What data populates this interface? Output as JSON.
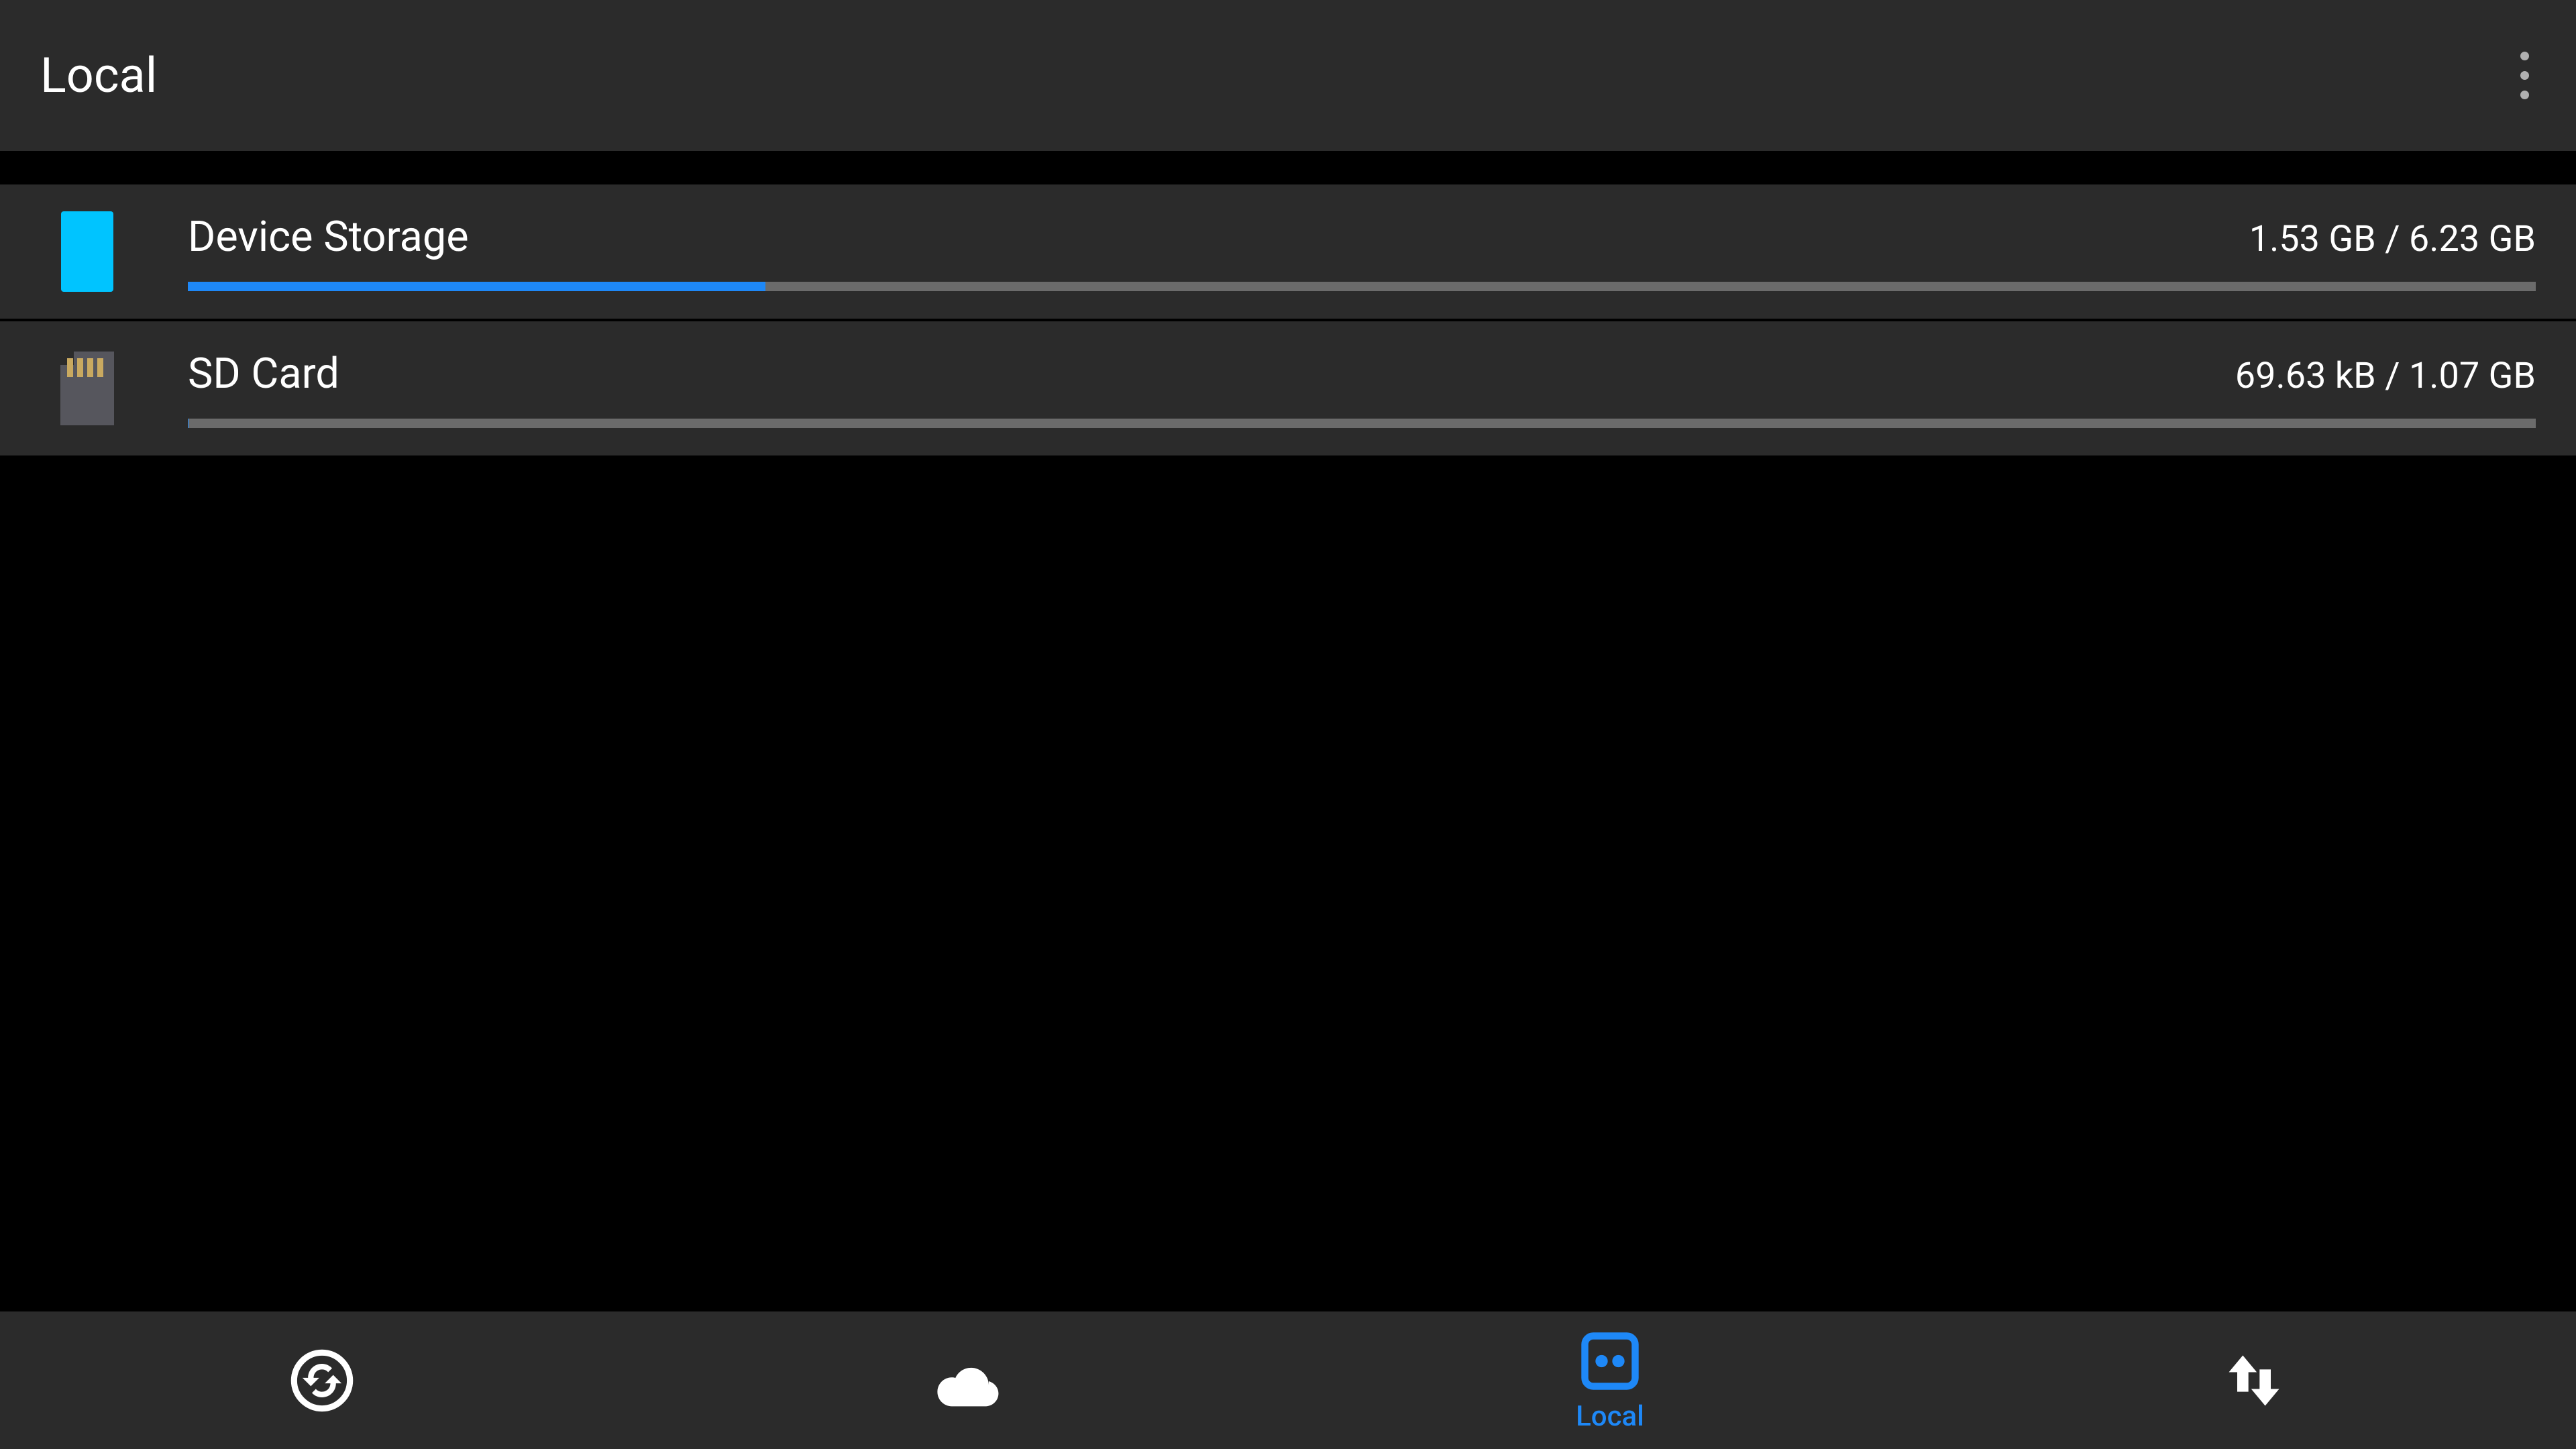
{
  "header": {
    "title": "Local"
  },
  "storage": [
    {
      "name": "Device Storage",
      "size": "1.53 GB / 6.23 GB",
      "fill_percent": 24.6,
      "icon": "device"
    },
    {
      "name": "SD Card",
      "size": "69.63 kB / 1.07 GB",
      "fill_percent": 0.01,
      "icon": "sd"
    }
  ],
  "nav": {
    "items": [
      {
        "id": "sync",
        "label": ""
      },
      {
        "id": "cloud",
        "label": ""
      },
      {
        "id": "local",
        "label": "Local",
        "active": true
      },
      {
        "id": "transfer",
        "label": ""
      }
    ]
  },
  "colors": {
    "accent": "#1e88f7",
    "cyan": "#00c4ff"
  }
}
